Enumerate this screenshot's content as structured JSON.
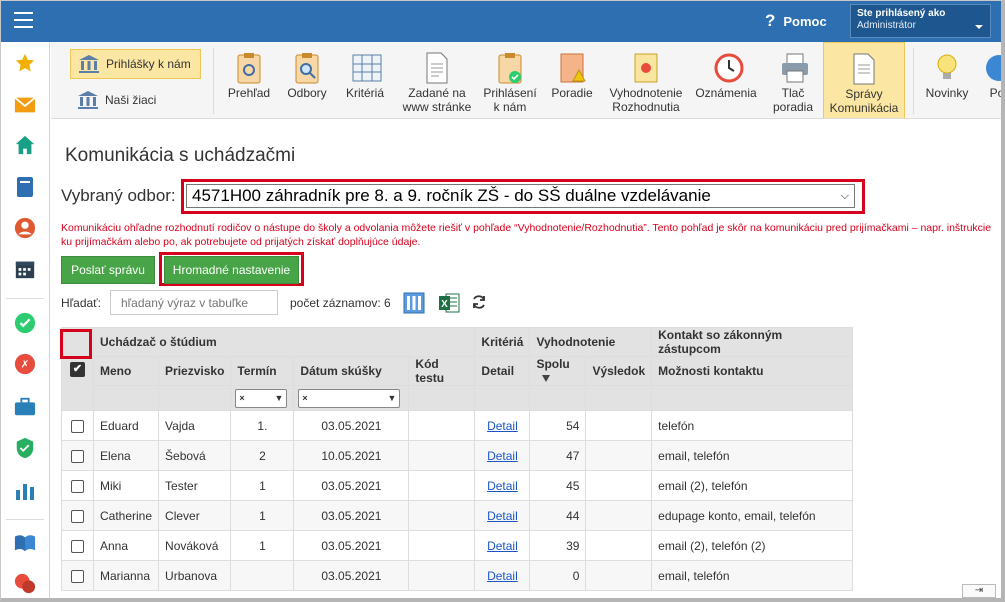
{
  "header": {
    "help_label": "Pomoc",
    "user_caption": "Ste prihlásený ako",
    "user_name": "Administrátor"
  },
  "sidebar": {
    "icons": [
      "star-icon",
      "mail-icon",
      "home-icon",
      "book-icon",
      "person-icon",
      "calendar-icon",
      "check-circle-icon",
      "dice-icon",
      "briefcase-icon",
      "shield-icon",
      "chart-icon",
      "open-book-icon",
      "chat-icon"
    ]
  },
  "ribbon": {
    "left_items": [
      {
        "label": "Prihlášky k nám",
        "selected": true
      },
      {
        "label": "Naši žiaci",
        "selected": false
      }
    ],
    "items": [
      {
        "label": "Prehľad"
      },
      {
        "label": "Odbory"
      },
      {
        "label": "Kritériá"
      },
      {
        "label": "Zadané na www stránke"
      },
      {
        "label": "Prihlásení k nám"
      },
      {
        "label": "Poradie"
      },
      {
        "label": "Vyhodnotenie Rozhodnutia"
      },
      {
        "label": "Oznámenia"
      },
      {
        "label": "Tlač poradia"
      },
      {
        "label": "Správy Komunikácia",
        "selected": true
      },
      {
        "label": "Novinky"
      },
      {
        "label": "Po"
      }
    ]
  },
  "page": {
    "title": "Komunikácia s uchádzačmi",
    "odbor_label": "Vybraný odbor:",
    "odbor_value": "4571H00 záhradník pre 8. a 9. ročník ZŠ - do SŠ duálne vzdelávanie",
    "warning": "Komunikáciu ohľadne rozhodnutí rodičov o nástupe do školy a odvolania môžete riešiť v pohľade “Vyhodnotenie/Rozhodnutia”. Tento pohľad je skôr na komunikáciu pred prijímačkami – napr. inštrukcie ku prijímačkám alebo po, ak potrebujete od prijatých získať doplňujúce údaje.",
    "send_button": "Poslať správu",
    "bulk_button": "Hromadné nastavenie",
    "search_label": "Hľadať:",
    "search_placeholder": "hľadaný výraz v tabuľke",
    "count_label": "počet záznamov: 6"
  },
  "table": {
    "groups": {
      "applicant": "Uchádzač o štúdium",
      "criteria": "Kritériá",
      "evaluation": "Vyhodnotenie",
      "contact": "Kontakt so zákonným zástupcom"
    },
    "columns": {
      "meno": "Meno",
      "priezvisko": "Priezvisko",
      "termin": "Termín",
      "datum": "Dátum skúšky",
      "kod": "Kód testu",
      "detail": "Detail",
      "spolu": "Spolu",
      "vysledok": "Výsledok",
      "kontakt": "Možnosti kontaktu"
    },
    "filter_placeholder": "×",
    "rows": [
      {
        "meno": "Eduard",
        "priezvisko": "Vajda",
        "termin": "1.",
        "datum": "03.05.2021",
        "kod": "",
        "detail": "Detail",
        "spolu": "54",
        "vysledok": "",
        "kontakt": "telefón"
      },
      {
        "meno": "Elena",
        "priezvisko": "Šebová",
        "termin": "2",
        "datum": "10.05.2021",
        "kod": "",
        "detail": "Detail",
        "spolu": "47",
        "vysledok": "",
        "kontakt": "email, telefón"
      },
      {
        "meno": "Miki",
        "priezvisko": "Tester",
        "termin": "1",
        "datum": "03.05.2021",
        "kod": "",
        "detail": "Detail",
        "spolu": "45",
        "vysledok": "",
        "kontakt": "email (2), telefón"
      },
      {
        "meno": "Catherine",
        "priezvisko": "Clever",
        "termin": "1",
        "datum": "03.05.2021",
        "kod": "",
        "detail": "Detail",
        "spolu": "44",
        "vysledok": "",
        "kontakt": "edupage konto, email, telefón"
      },
      {
        "meno": "Anna",
        "priezvisko": "Nováková",
        "termin": "1",
        "datum": "03.05.2021",
        "kod": "",
        "detail": "Detail",
        "spolu": "39",
        "vysledok": "",
        "kontakt": "email (2), telefón (2)"
      },
      {
        "meno": "Marianna",
        "priezvisko": "Urbanova",
        "termin": "",
        "datum": "03.05.2021",
        "kod": "",
        "detail": "Detail",
        "spolu": "0",
        "vysledok": "",
        "kontakt": "email, telefón"
      }
    ]
  },
  "colors": {
    "topbar": "#2d6fb0",
    "accent_green": "#47a447",
    "highlight_red": "#d6001c",
    "ribbon_selected": "#fbe7a3"
  }
}
